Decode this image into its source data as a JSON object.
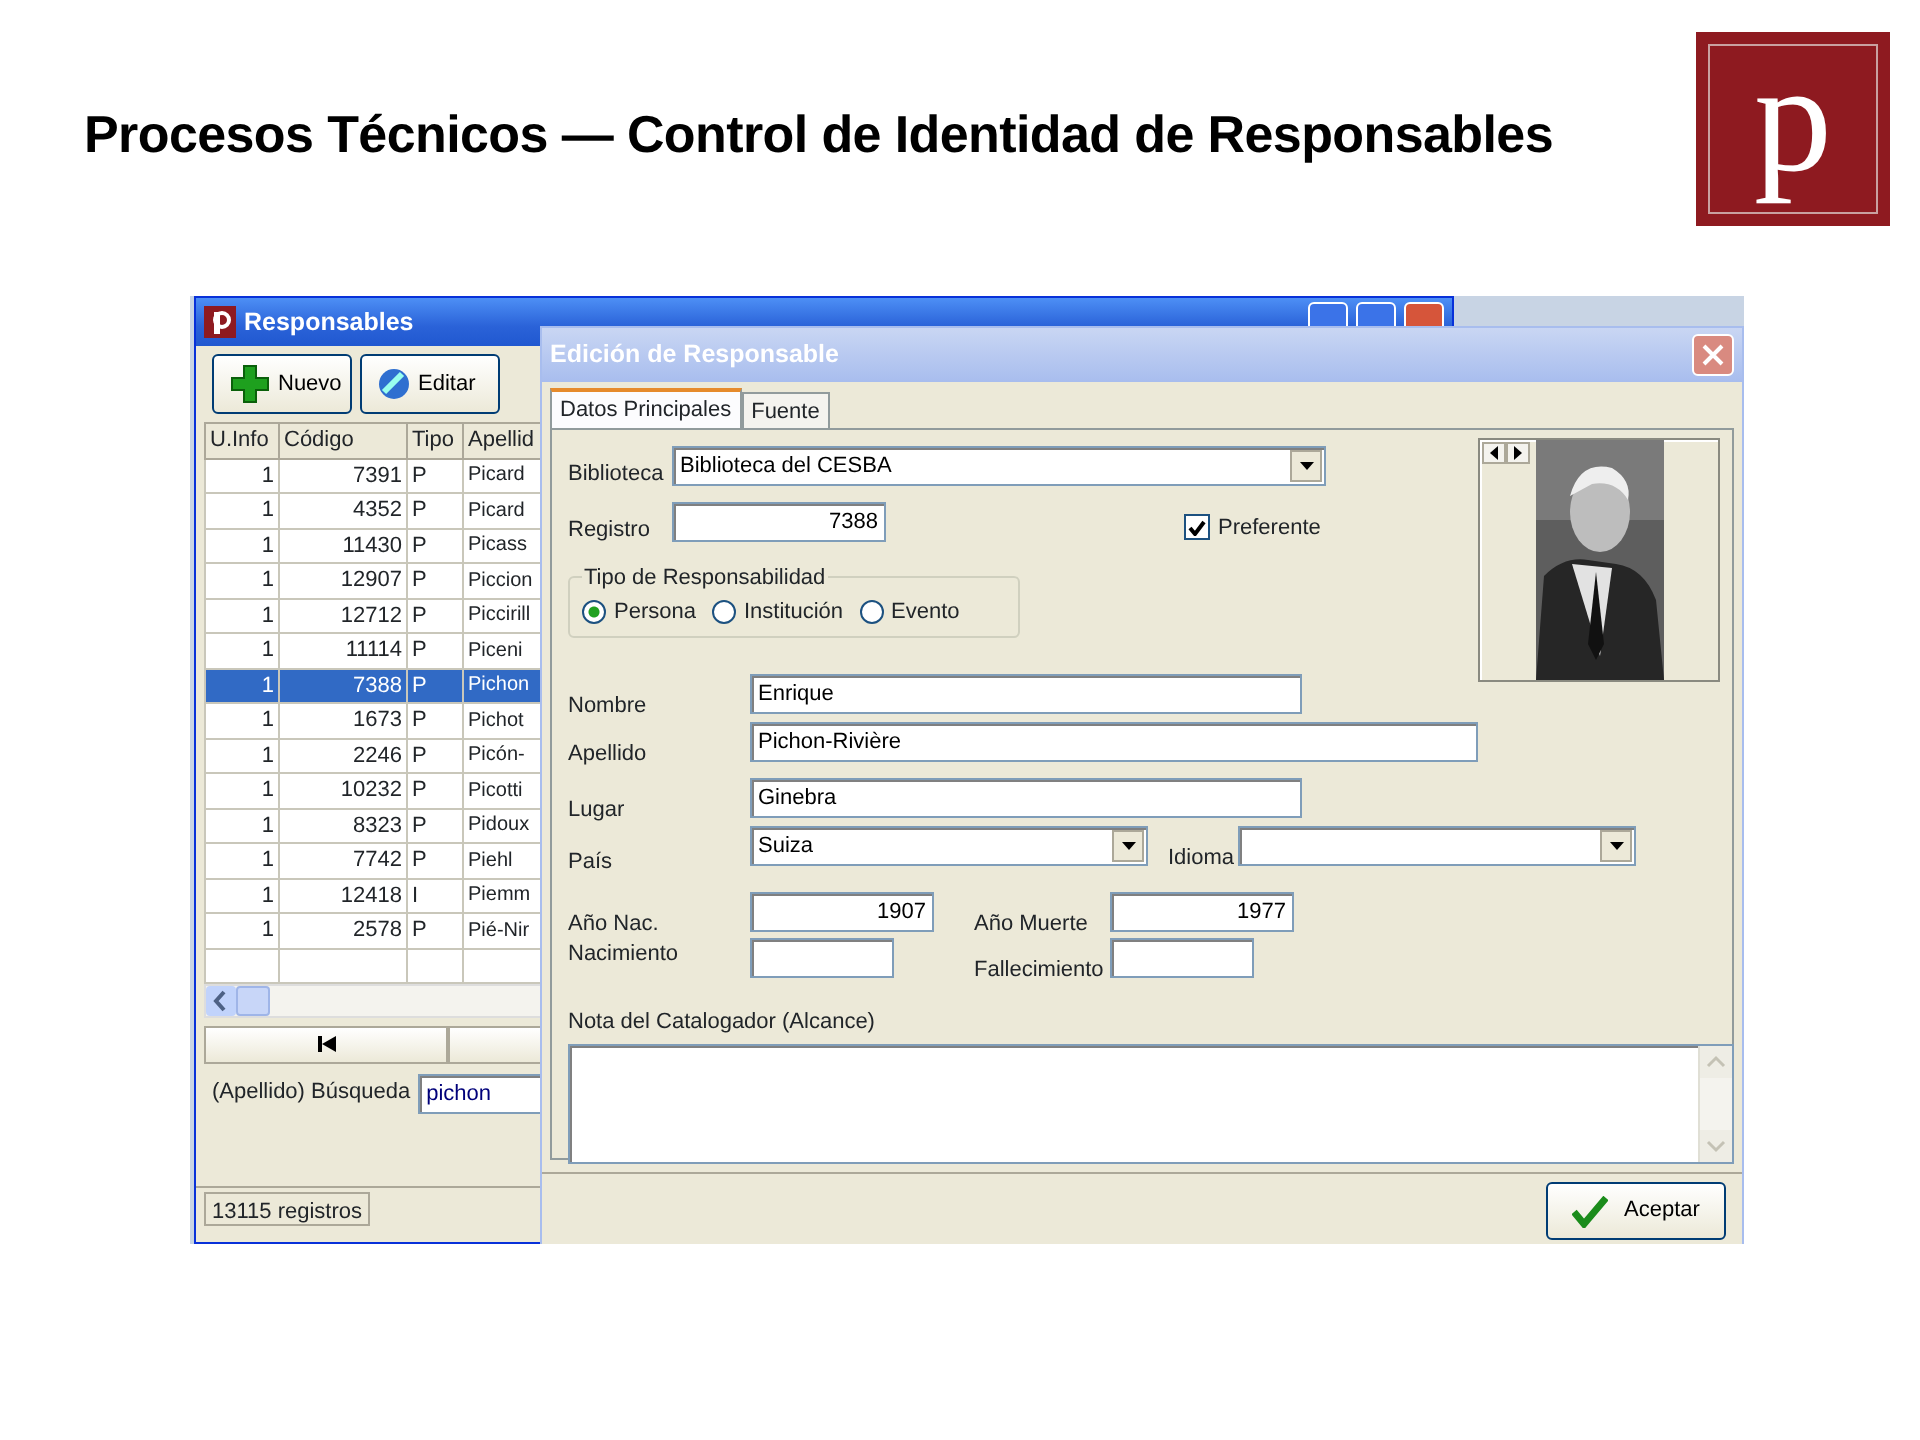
{
  "slide": {
    "title": "Procesos Técnicos — Control de Identidad de Responsables",
    "logo": "p"
  },
  "list_window": {
    "title": "Responsables",
    "toolbar": [
      {
        "label": "Nuevo",
        "kind": "add"
      },
      {
        "label": "Editar",
        "kind": "edit"
      }
    ],
    "columns": [
      "U.Info",
      "Código",
      "Tipo",
      "Apellid"
    ],
    "rows": [
      {
        "cells": [
          "1",
          "7391",
          "P",
          "Picard"
        ],
        "selected": false
      },
      {
        "cells": [
          "1",
          "4352",
          "P",
          "Picard"
        ],
        "selected": false
      },
      {
        "cells": [
          "1",
          "11430",
          "P",
          "Picass"
        ],
        "selected": false
      },
      {
        "cells": [
          "1",
          "12907",
          "P",
          "Piccion"
        ],
        "selected": false
      },
      {
        "cells": [
          "1",
          "12712",
          "P",
          "Piccirill"
        ],
        "selected": false
      },
      {
        "cells": [
          "1",
          "11114",
          "P",
          "Piceni"
        ],
        "selected": false
      },
      {
        "cells": [
          "1",
          "7388",
          "P",
          "Pichon"
        ],
        "selected": true
      },
      {
        "cells": [
          "1",
          "1673",
          "P",
          "Pichot"
        ],
        "selected": false
      },
      {
        "cells": [
          "1",
          "2246",
          "P",
          "Picón-"
        ],
        "selected": false
      },
      {
        "cells": [
          "1",
          "10232",
          "P",
          "Picotti"
        ],
        "selected": false
      },
      {
        "cells": [
          "1",
          "8323",
          "P",
          "Pidoux"
        ],
        "selected": false
      },
      {
        "cells": [
          "1",
          "7742",
          "P",
          "Piehl"
        ],
        "selected": false
      },
      {
        "cells": [
          "1",
          "12418",
          "I",
          "Piemm"
        ],
        "selected": false
      },
      {
        "cells": [
          "1",
          "2578",
          "P",
          "Pié-Nir"
        ],
        "selected": false
      }
    ],
    "search": {
      "label": "(Apellido) Búsqueda",
      "value": "pichon"
    },
    "status_bar": "13115 registros"
  },
  "dialog": {
    "title": "Edición de Responsable",
    "tabs": [
      {
        "label": "Datos Principales",
        "selected": true
      },
      {
        "label": "Fuente",
        "selected": false
      }
    ],
    "fields": {
      "biblioteca": {
        "label": "Biblioteca",
        "value": "Biblioteca del CESBA",
        "kind": "dropdown"
      },
      "registro": {
        "label": "Registro",
        "value": "7388",
        "kind": "number"
      },
      "nombre": {
        "label": "Nombre",
        "value": "Enrique",
        "kind": "text"
      },
      "apellido": {
        "label": "Apellido",
        "value": "Pichon-Rivière",
        "kind": "text"
      },
      "lugar": {
        "label": "Lugar",
        "value": "Ginebra",
        "kind": "text"
      },
      "pais": {
        "label": "País",
        "value": "Suiza",
        "kind": "dropdown"
      },
      "idioma": {
        "label": "Idioma",
        "kind": "dropdown"
      },
      "anio_nac": {
        "label": "Año Nac.",
        "value": "1907",
        "kind": "number"
      },
      "anio_muerte": {
        "label": "Año Muerte",
        "value": "1977",
        "kind": "number"
      },
      "nacimiento": {
        "label": "Nacimiento",
        "kind": "text"
      },
      "fallecimiento": {
        "label": "Fallecimiento",
        "kind": "text"
      }
    },
    "preferente": {
      "label": "Preferente",
      "checked": true
    },
    "tipo": {
      "legend": "Tipo de Responsabilidad",
      "options": [
        {
          "label": "Persona",
          "selected": true
        },
        {
          "label": "Institución",
          "selected": false
        },
        {
          "label": "Evento",
          "selected": false
        }
      ]
    },
    "nota": {
      "label": "Nota del Catalogador (Alcance)"
    },
    "accept_button": "Aceptar"
  }
}
